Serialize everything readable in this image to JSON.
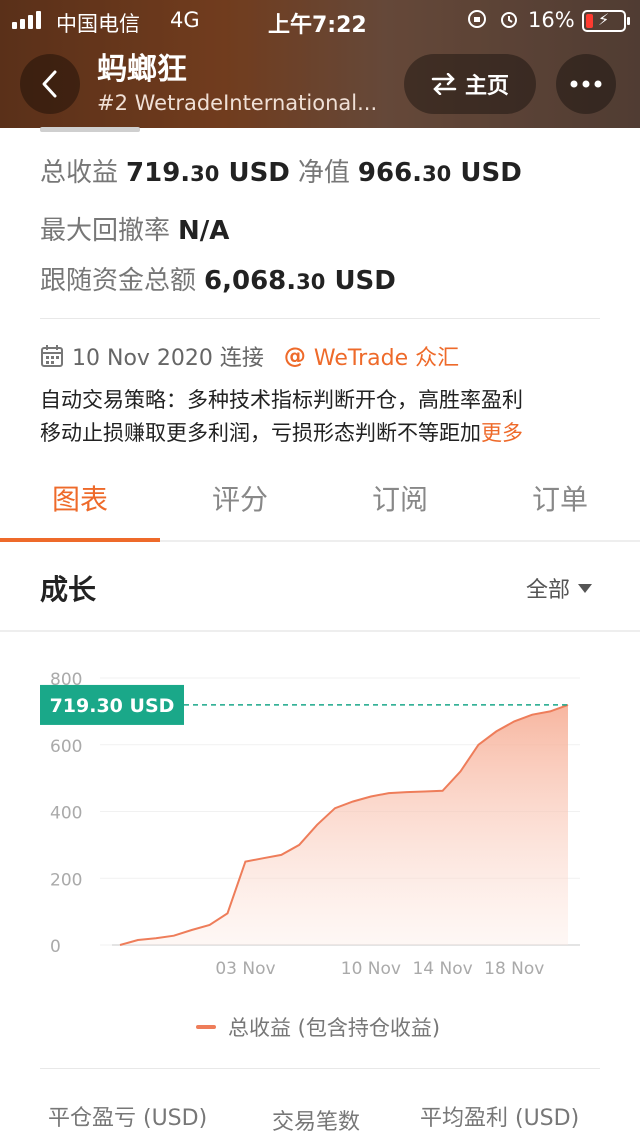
{
  "status_bar": {
    "carrier": "中国电信",
    "network": "4G",
    "time": "上午7:22",
    "battery": "16%"
  },
  "nav": {
    "title": "蚂螂狂",
    "subtitle": "#2 WetradeInternational...",
    "home_label": "主页"
  },
  "stats": {
    "total_profit_label": "总收益",
    "total_profit_int": "719.",
    "total_profit_dec": "30",
    "total_profit_unit": "USD",
    "equity_label": "净值",
    "equity_int": "966.",
    "equity_dec": "30",
    "equity_unit": "USD",
    "drawdown_label": "最大回撤率",
    "drawdown_value": "N/A",
    "follow_label": "跟随资金总额",
    "follow_int": "6,068.",
    "follow_dec": "30",
    "follow_unit": "USD"
  },
  "meta": {
    "connect_date": "10 Nov 2020 连接",
    "broker": "WeTrade 众汇"
  },
  "description": {
    "line1": "自动交易策略：多种技术指标判断开仓，高胜率盈利",
    "line2": "移动止损赚取更多利润，亏损形态判断不等距加",
    "more": "更多"
  },
  "tabs": [
    {
      "label": "图表",
      "active": true
    },
    {
      "label": "评分",
      "active": false
    },
    {
      "label": "订阅",
      "active": false
    },
    {
      "label": "订单",
      "active": false
    }
  ],
  "growth": {
    "title": "成长",
    "range": "全部"
  },
  "chart_data": {
    "type": "area",
    "x": [
      "27 Oct",
      "28 Oct",
      "29 Oct",
      "30 Oct",
      "31 Oct",
      "01 Nov",
      "02 Nov",
      "03 Nov",
      "04 Nov",
      "05 Nov",
      "06 Nov",
      "07 Nov",
      "08 Nov",
      "09 Nov",
      "10 Nov",
      "11 Nov",
      "12 Nov",
      "13 Nov",
      "14 Nov",
      "15 Nov",
      "16 Nov",
      "17 Nov",
      "18 Nov",
      "19 Nov",
      "20 Nov",
      "21 Nov"
    ],
    "series": [
      {
        "name": "总收益 (包含持仓收益)",
        "values": [
          0,
          15,
          20,
          28,
          45,
          60,
          95,
          250,
          260,
          270,
          300,
          360,
          410,
          430,
          445,
          455,
          458,
          460,
          462,
          520,
          600,
          640,
          670,
          690,
          700,
          719.3
        ]
      }
    ],
    "xticks": [
      "03 Nov",
      "10 Nov",
      "14 Nov",
      "18 Nov"
    ],
    "xtick_positions": [
      "03 Nov",
      "10 Nov",
      "14 Nov",
      "18 Nov"
    ],
    "yticks": [
      0,
      200,
      400,
      600,
      800
    ],
    "ylim": [
      0,
      800
    ],
    "current_value_label": "719.30 USD",
    "current_value": 719.3,
    "line_color": "#ee7d5a",
    "badge_color": "#1aa889",
    "grid": true,
    "legend_position": "bottom"
  },
  "legend": {
    "label": "总收益 (包含持仓收益)"
  },
  "bottom_columns": {
    "col1": "平仓盈亏 (USD)",
    "col2": "交易笔数",
    "col3": "平均盈利 (USD)"
  }
}
